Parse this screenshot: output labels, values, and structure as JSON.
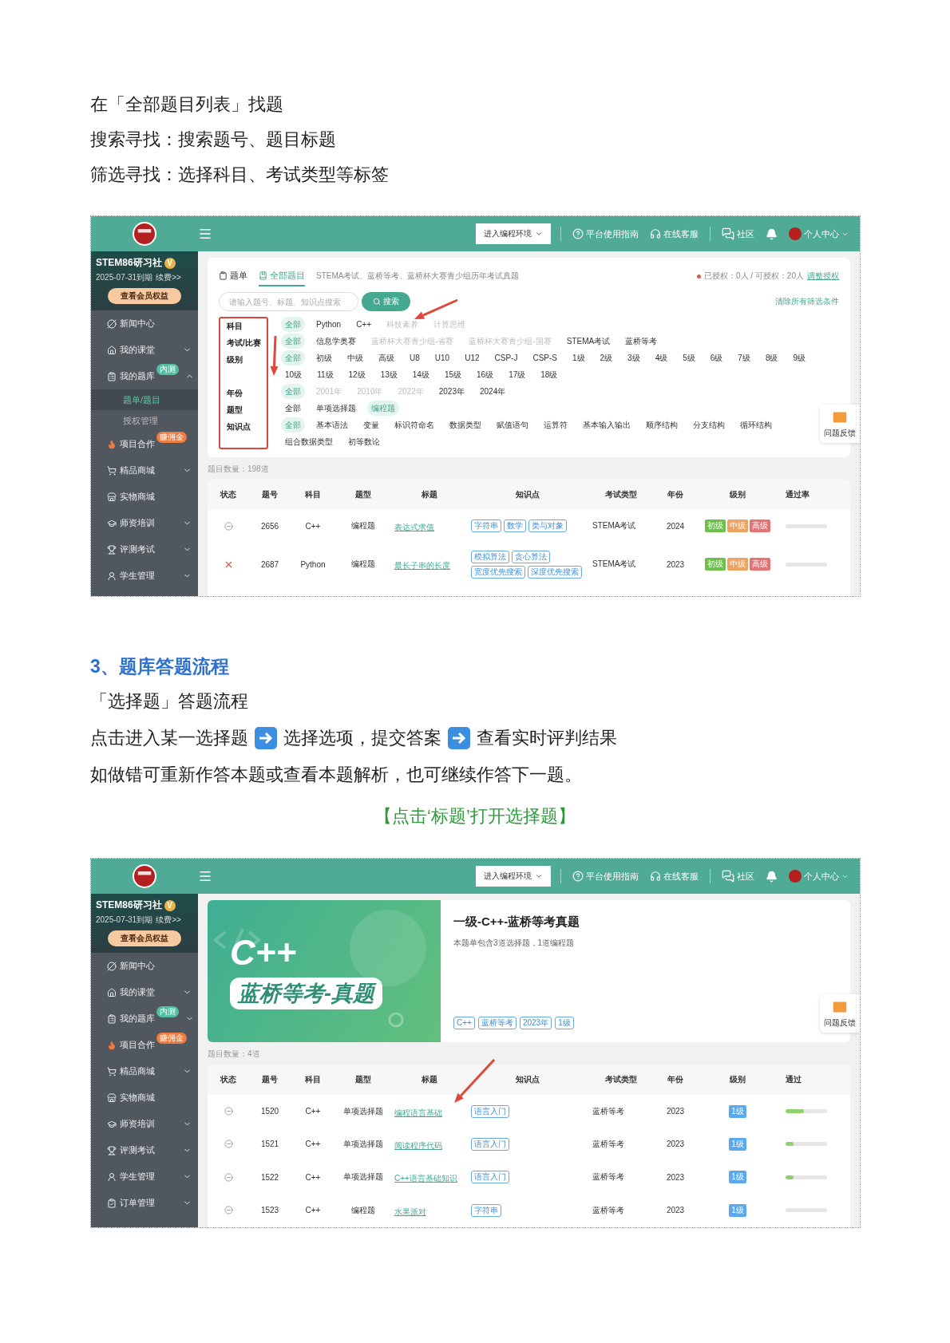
{
  "intro": [
    "在「全部题目列表」找题",
    "搜索寻找：搜索题号、题目标题",
    "筛选寻找：选择科目、考试类型等标签"
  ],
  "shot1": {
    "header": {
      "env_button": "进入编程环境",
      "guide": "平台使用指南",
      "service": "在线客服",
      "community": "社区",
      "user": "个人中心"
    },
    "sidebar": {
      "brand": "STEM86研习社",
      "vip": "V",
      "expiry": "2025-07-31到期",
      "renew": "续费>>",
      "benefits_button": "查看会员权益",
      "items": [
        {
          "label": "新闻中心",
          "selected": false
        },
        {
          "label": "我的课堂",
          "selected": false,
          "expanded": false
        },
        {
          "label": "我的题库",
          "selected": false,
          "expanded": true,
          "badge": "内测",
          "children": [
            {
              "label": "题单/题目",
              "selected": true
            },
            {
              "label": "授权管理",
              "selected": false
            }
          ]
        },
        {
          "label": "项目合作",
          "selected": false,
          "badge": "赚佣金"
        },
        {
          "label": "精品商城",
          "selected": false,
          "expanded": false
        },
        {
          "label": "实物商城",
          "selected": false
        },
        {
          "label": "师资培训",
          "selected": false,
          "expanded": false
        },
        {
          "label": "评测考试",
          "selected": false,
          "expanded": false
        },
        {
          "label": "学生管理",
          "selected": false,
          "expanded": false
        }
      ]
    },
    "main": {
      "tabs": [
        {
          "label": "题单",
          "selected": false
        },
        {
          "label": "全部题目",
          "selected": true
        }
      ],
      "tab_note": "STEMA考试、蓝桥等考、蓝桥杯大赛青少组历年考试真题",
      "auth_text": "已授权：0人 / 可授权：20人",
      "auth_link": "调整授权",
      "search": {
        "placeholder": "请输入题号、标题、知识点搜索",
        "button": "搜索"
      },
      "clear_link": "清除所有筛选条件",
      "filters": [
        {
          "label": "科目",
          "options": [
            {
              "text": "全部",
              "selected": true,
              "disabled": false
            },
            {
              "text": "Python",
              "selected": false,
              "disabled": false
            },
            {
              "text": "C++",
              "selected": false,
              "disabled": false
            },
            {
              "text": "科技素养",
              "selected": false,
              "disabled": true
            },
            {
              "text": "计算思维",
              "selected": false,
              "disabled": true
            }
          ]
        },
        {
          "label": "考试/比赛",
          "options": [
            {
              "text": "全部",
              "selected": true,
              "disabled": false
            },
            {
              "text": "信息学奥赛",
              "selected": false,
              "disabled": false
            },
            {
              "text": "蓝桥杯大赛青少组-省赛",
              "selected": false,
              "disabled": true
            },
            {
              "text": "蓝桥杯大赛青少组-国赛",
              "selected": false,
              "disabled": true
            },
            {
              "text": "STEMA考试",
              "selected": false,
              "disabled": false
            },
            {
              "text": "蓝桥等考",
              "selected": false,
              "disabled": false
            }
          ]
        },
        {
          "label": "级别",
          "options": [
            {
              "text": "全部",
              "selected": true,
              "disabled": false
            },
            {
              "text": "初级",
              "selected": false,
              "disabled": false
            },
            {
              "text": "中级",
              "selected": false,
              "disabled": false
            },
            {
              "text": "高级",
              "selected": false,
              "disabled": false
            },
            {
              "text": "U8",
              "selected": false,
              "disabled": false
            },
            {
              "text": "U10",
              "selected": false,
              "disabled": false
            },
            {
              "text": "U12",
              "selected": false,
              "disabled": false
            },
            {
              "text": "CSP-J",
              "selected": false,
              "disabled": false
            },
            {
              "text": "CSP-S",
              "selected": false,
              "disabled": false
            },
            {
              "text": "1级",
              "selected": false,
              "disabled": false
            },
            {
              "text": "2级",
              "selected": false,
              "disabled": false
            },
            {
              "text": "3级",
              "selected": false,
              "disabled": false
            },
            {
              "text": "4级",
              "selected": false,
              "disabled": false
            },
            {
              "text": "5级",
              "selected": false,
              "disabled": false
            },
            {
              "text": "6级",
              "selected": false,
              "disabled": false
            },
            {
              "text": "7级",
              "selected": false,
              "disabled": false
            },
            {
              "text": "8级",
              "selected": false,
              "disabled": false
            },
            {
              "text": "9级",
              "selected": false,
              "disabled": false
            },
            {
              "text": "10级",
              "selected": false,
              "disabled": false
            },
            {
              "text": "11级",
              "selected": false,
              "disabled": false
            },
            {
              "text": "12级",
              "selected": false,
              "disabled": false
            },
            {
              "text": "13级",
              "selected": false,
              "disabled": false
            },
            {
              "text": "14级",
              "selected": false,
              "disabled": false
            },
            {
              "text": "15级",
              "selected": false,
              "disabled": false
            },
            {
              "text": "16级",
              "selected": false,
              "disabled": false
            },
            {
              "text": "17级",
              "selected": false,
              "disabled": false
            },
            {
              "text": "18级",
              "selected": false,
              "disabled": false
            }
          ]
        },
        {
          "label": "年份",
          "options": [
            {
              "text": "全部",
              "selected": true,
              "disabled": false
            },
            {
              "text": "2001年",
              "selected": false,
              "disabled": true
            },
            {
              "text": "2010年",
              "selected": false,
              "disabled": true
            },
            {
              "text": "2022年",
              "selected": false,
              "disabled": true
            },
            {
              "text": "2023年",
              "selected": false,
              "disabled": false
            },
            {
              "text": "2024年",
              "selected": false,
              "disabled": false
            }
          ]
        },
        {
          "label": "题型",
          "options": [
            {
              "text": "全部",
              "selected": false,
              "disabled": false
            },
            {
              "text": "单项选择题",
              "selected": false,
              "disabled": false
            },
            {
              "text": "编程题",
              "selected": true,
              "disabled": false
            }
          ]
        },
        {
          "label": "知识点",
          "options": [
            {
              "text": "全部",
              "selected": true,
              "disabled": false
            },
            {
              "text": "基本语法",
              "selected": false,
              "disabled": false
            },
            {
              "text": "变量",
              "selected": false,
              "disabled": false
            },
            {
              "text": "标识符命名",
              "selected": false,
              "disabled": false
            },
            {
              "text": "数据类型",
              "selected": false,
              "disabled": false
            },
            {
              "text": "赋值语句",
              "selected": false,
              "disabled": false
            },
            {
              "text": "运算符",
              "selected": false,
              "disabled": false
            },
            {
              "text": "基本输入输出",
              "selected": false,
              "disabled": false
            },
            {
              "text": "顺序结构",
              "selected": false,
              "disabled": false
            },
            {
              "text": "分支结构",
              "selected": false,
              "disabled": false
            },
            {
              "text": "循环结构",
              "selected": false,
              "disabled": false
            },
            {
              "text": "组合数据类型",
              "selected": false,
              "disabled": false
            },
            {
              "text": "初等数论",
              "selected": false,
              "disabled": false
            }
          ]
        }
      ],
      "count": "题目数量：198道",
      "table": {
        "columns": [
          "状态",
          "题号",
          "科目",
          "题型",
          "标题",
          "知识点",
          "考试类型",
          "年份",
          "级别",
          "通过率"
        ],
        "rows": [
          {
            "kind": "unanswered",
            "id": "2656",
            "subject": "C++",
            "type": "编程题",
            "title": "表达式求值",
            "tags": [
              "字符串",
              "数学",
              "类与对象"
            ],
            "exam": "STEMA考试",
            "year": "2024",
            "grades": [
              {
                "text": "初级",
                "color": "#6cc04a"
              },
              {
                "text": "中级",
                "color": "#f0a35e"
              },
              {
                "text": "高级",
                "color": "#e57373"
              }
            ]
          },
          {
            "kind": "wrong",
            "id": "2687",
            "subject": "Python",
            "type": "编程题",
            "title": "最长子串的长度",
            "tags": [
              "模拟算法",
              "贪心算法",
              "宽度优先搜索",
              "深度优先搜索"
            ],
            "exam": "STEMA考试",
            "year": "2023",
            "grades": [
              {
                "text": "初级",
                "color": "#6cc04a"
              },
              {
                "text": "中级",
                "color": "#f0a35e"
              },
              {
                "text": "高级",
                "color": "#e57373"
              }
            ]
          }
        ]
      }
    },
    "feedback": "问题反馈"
  },
  "section": {
    "heading": "3、题库答题流程",
    "subheading": "「选择题」答题流程",
    "steps": [
      "点击进入某一选择题",
      "选择选项，提交答案",
      "查看实时评判结果"
    ],
    "note": "如做错可重新作答本题或查看本题解析，也可继续作答下一题。",
    "caption": "【点击‘标题’打开选择题】"
  },
  "shot2": {
    "header": {
      "env_button": "进入编程环境",
      "guide": "平台使用指南",
      "service": "在线客服",
      "community": "社区",
      "user": "个人中心"
    },
    "sidebar": {
      "brand": "STEM86研习社",
      "vip": "V",
      "expiry": "2025-07-31到期",
      "renew": "续费>>",
      "benefits_button": "查看会员权益",
      "items": [
        {
          "label": "新闻中心",
          "selected": false
        },
        {
          "label": "我的课堂",
          "selected": false,
          "expanded": false
        },
        {
          "label": "我的题库",
          "selected": false,
          "expanded": false,
          "badge": "内测"
        },
        {
          "label": "项目合作",
          "selected": false,
          "badge": "赚佣金"
        },
        {
          "label": "精品商城",
          "selected": false,
          "expanded": false
        },
        {
          "label": "实物商城",
          "selected": false
        },
        {
          "label": "师资培训",
          "selected": false,
          "expanded": false
        },
        {
          "label": "评测考试",
          "selected": false,
          "expanded": false
        },
        {
          "label": "学生管理",
          "selected": false,
          "expanded": false
        },
        {
          "label": "订单管理",
          "selected": false,
          "expanded": false
        }
      ]
    },
    "main": {
      "card": {
        "cover_title": "C++",
        "cover_subtitle": "蓝桥等考-真题",
        "title": "一级-C++-蓝桥等考真题",
        "description": "本题单包含3道选择题，1道编程题",
        "tags": [
          "C++",
          "蓝桥等考",
          "2023年",
          "1级"
        ]
      },
      "count": "题目数量：4道",
      "table": {
        "columns": [
          "状态",
          "题号",
          "科目",
          "题型",
          "标题",
          "知识点",
          "考试类型",
          "年份",
          "级别",
          "通过"
        ],
        "rows": [
          {
            "kind": "unanswered",
            "id": "1520",
            "subject": "C++",
            "type": "单项选择题",
            "title": "编程语言基础",
            "tags": [
              "语言入门"
            ],
            "exam": "蓝桥等考",
            "year": "2023",
            "grades": [
              {
                "text": "1级",
                "color": "#5aa9f0"
              }
            ],
            "level": 0.45
          },
          {
            "kind": "unanswered",
            "id": "1521",
            "subject": "C++",
            "type": "单项选择题",
            "title": "阅读程序代码",
            "tags": [
              "语言入门"
            ],
            "exam": "蓝桥等考",
            "year": "2023",
            "grades": [
              {
                "text": "1级",
                "color": "#5aa9f0"
              }
            ],
            "level": 0.2
          },
          {
            "kind": "unanswered",
            "id": "1522",
            "subject": "C++",
            "type": "单项选择题",
            "title": "C++语言基础知识",
            "tags": [
              "语言入门"
            ],
            "exam": "蓝桥等考",
            "year": "2023",
            "grades": [
              {
                "text": "1级",
                "color": "#5aa9f0"
              }
            ],
            "level": 0.2
          },
          {
            "kind": "unanswered",
            "id": "1523",
            "subject": "C++",
            "type": "编程题",
            "title": "水果派对",
            "tags": [
              "字符串"
            ],
            "exam": "蓝桥等考",
            "year": "2023",
            "grades": [
              {
                "text": "1级",
                "color": "#5aa9f0"
              }
            ]
          }
        ]
      }
    },
    "feedback": "问题反馈"
  }
}
